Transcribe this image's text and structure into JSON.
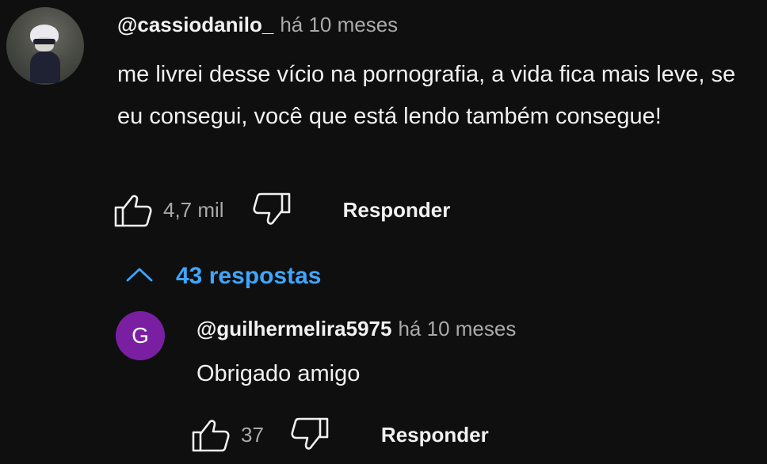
{
  "comment": {
    "author": "@cassiodanilo_",
    "time": "há 10 meses",
    "text": "me livrei desse vício na pornografia, a vida fica mais leve, se eu consegui, você que está lendo também consegue!",
    "likes": "4,7 mil",
    "reply_label": "Responder",
    "icons": {
      "like": "thumbs-up-icon",
      "dislike": "thumbs-down-icon"
    }
  },
  "replies_toggle": {
    "label": "43 respostas",
    "icon": "chevron-up-icon",
    "color": "#3ea6ff"
  },
  "reply": {
    "avatar_letter": "G",
    "avatar_color": "#7b1fa2",
    "author": "@guilhermelira5975",
    "time": "há 10 meses",
    "text": "Obrigado amigo",
    "likes": "37",
    "reply_label": "Responder"
  }
}
